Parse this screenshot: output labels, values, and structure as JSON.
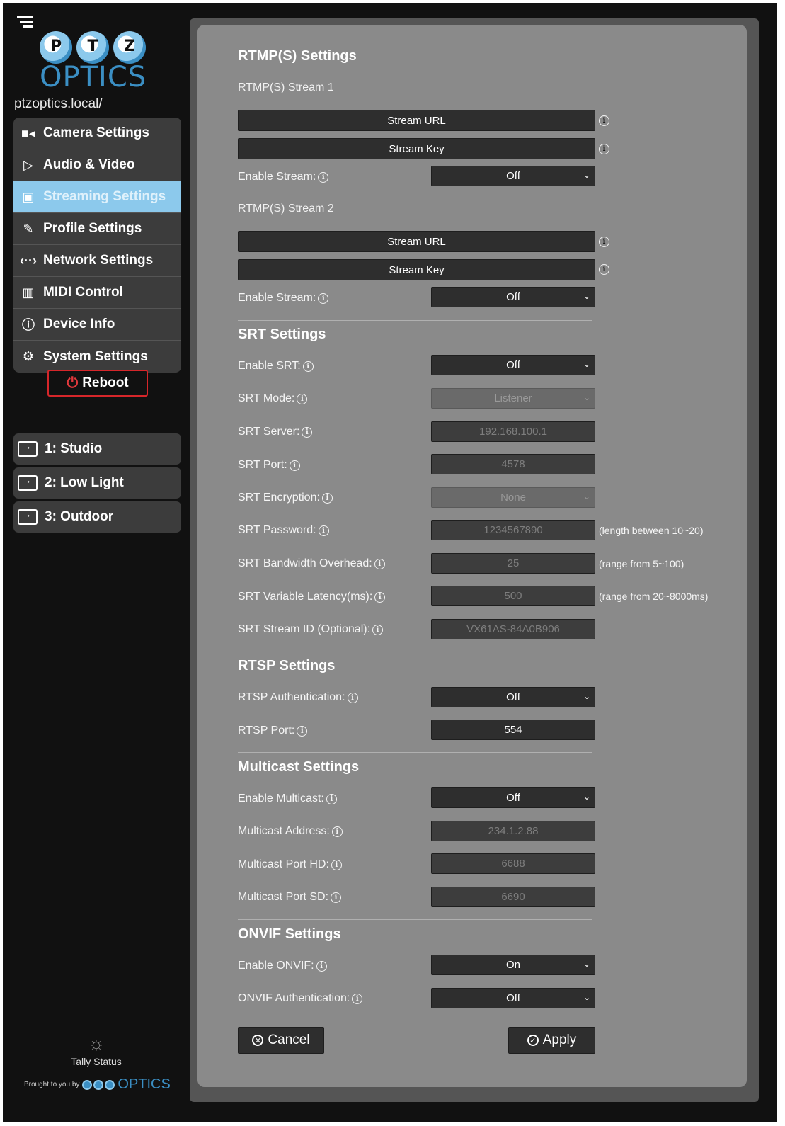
{
  "sidebar": {
    "host": "ptzoptics.local/",
    "logo_letters": [
      "P",
      "T",
      "Z"
    ],
    "logo_word": "OPTICS",
    "nav": [
      {
        "label": "Camera Settings",
        "icon": "camera-icon"
      },
      {
        "label": "Audio & Video",
        "icon": "audio-video-icon"
      },
      {
        "label": "Streaming Settings",
        "icon": "streaming-icon",
        "active": true
      },
      {
        "label": "Profile Settings",
        "icon": "palette-icon"
      },
      {
        "label": "Network Settings",
        "icon": "network-icon"
      },
      {
        "label": "MIDI Control",
        "icon": "midi-icon"
      },
      {
        "label": "Device Info",
        "icon": "info-icon"
      },
      {
        "label": "System Settings",
        "icon": "gear-icon"
      }
    ],
    "reboot": "Reboot",
    "presets": [
      "1: Studio",
      "2: Low Light",
      "3: Outdoor"
    ],
    "tally": "Tally Status",
    "brought": "Brought to you by",
    "brought_word": "OPTICS"
  },
  "rtmp": {
    "title": "RTMP(S) Settings",
    "stream1": "RTMP(S) Stream 1",
    "stream2": "RTMP(S) Stream 2",
    "stream_url": "Stream URL",
    "stream_key": "Stream Key",
    "enable_label": "Enable Stream:",
    "enable1": "Off",
    "enable2": "Off"
  },
  "srt": {
    "title": "SRT Settings",
    "enable_label": "Enable SRT:",
    "enable": "Off",
    "mode_label": "SRT Mode:",
    "mode": "Listener",
    "server_label": "SRT Server:",
    "server": "192.168.100.1",
    "port_label": "SRT Port:",
    "port": "4578",
    "enc_label": "SRT Encryption:",
    "enc": "None",
    "pass_label": "SRT Password:",
    "pass": "1234567890",
    "pass_hint": "(length between 10~20)",
    "bw_label": "SRT Bandwidth Overhead:",
    "bw": "25",
    "bw_hint": "(range from 5~100)",
    "lat_label": "SRT Variable Latency(ms):",
    "lat": "500",
    "lat_hint": "(range from 20~8000ms)",
    "sid_label": "SRT Stream ID (Optional):",
    "sid": "VX61AS-84A0B906"
  },
  "rtsp": {
    "title": "RTSP Settings",
    "auth_label": "RTSP Authentication:",
    "auth": "Off",
    "port_label": "RTSP Port:",
    "port": "554"
  },
  "multicast": {
    "title": "Multicast Settings",
    "enable_label": "Enable Multicast:",
    "enable": "Off",
    "addr_label": "Multicast Address:",
    "addr": "234.1.2.88",
    "hd_label": "Multicast Port HD:",
    "hd": "6688",
    "sd_label": "Multicast Port SD:",
    "sd": "6690"
  },
  "onvif": {
    "title": "ONVIF Settings",
    "enable_label": "Enable ONVIF:",
    "enable": "On",
    "auth_label": "ONVIF Authentication:",
    "auth": "Off"
  },
  "actions": {
    "cancel": "Cancel",
    "apply": "Apply"
  }
}
